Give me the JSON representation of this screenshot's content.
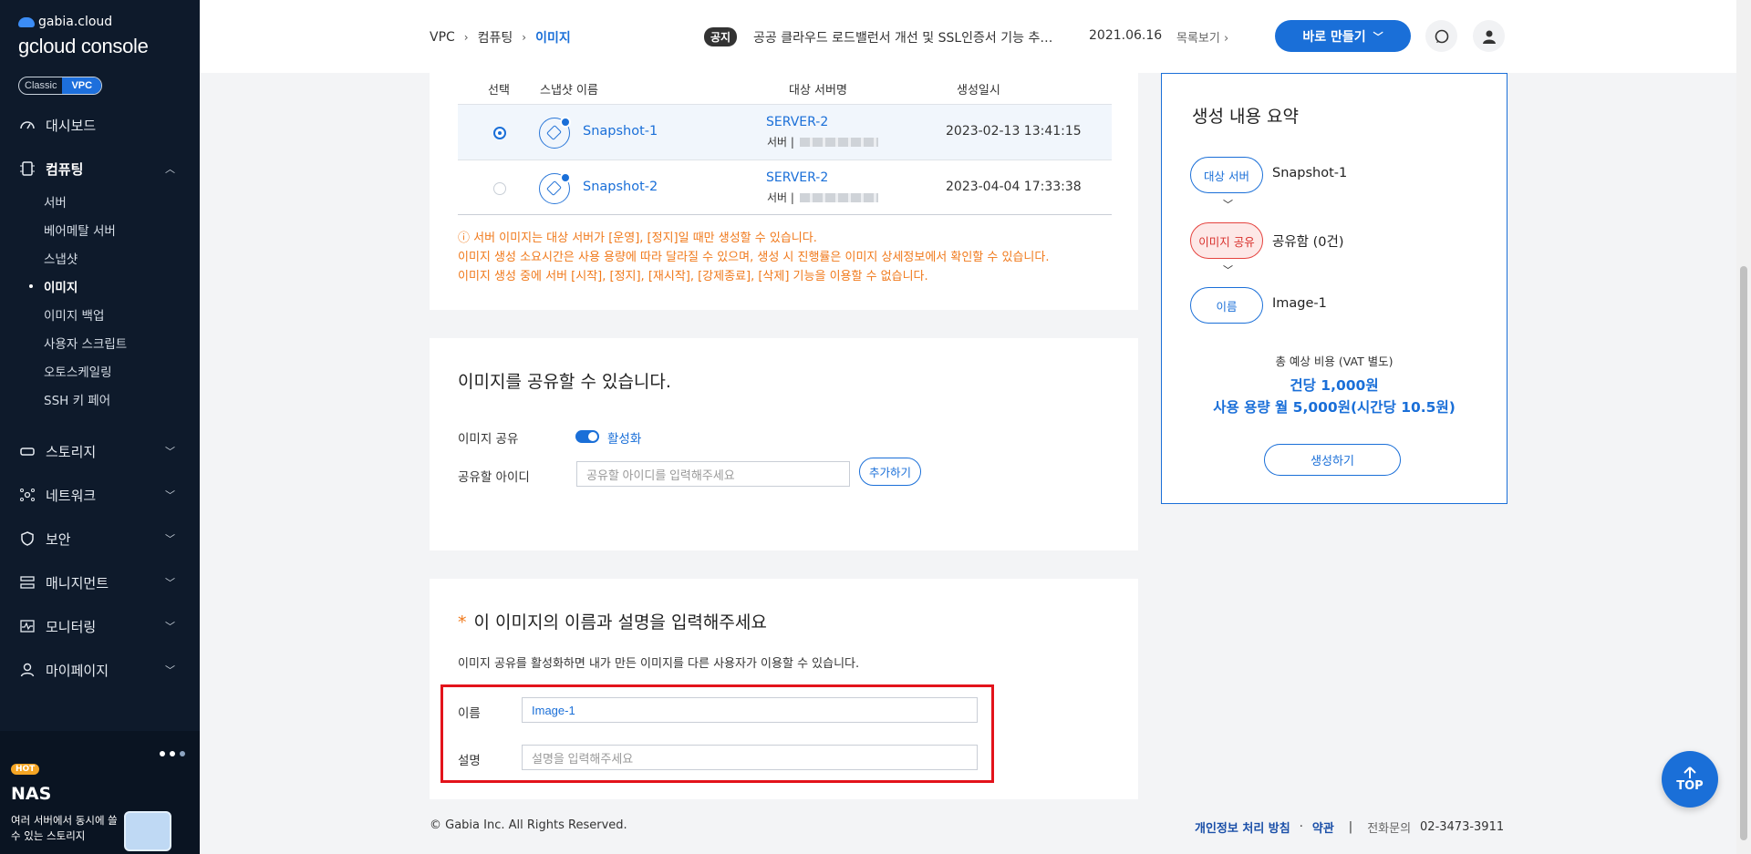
{
  "sidebar": {
    "brand_top": "gabia.cloud",
    "brand_main": "gcloud console",
    "mode_classic": "Classic",
    "mode_vpc": "VPC",
    "nav": [
      {
        "label": "대시보드"
      },
      {
        "label": "컴퓨팅"
      },
      {
        "label": "스토리지"
      },
      {
        "label": "네트워크"
      },
      {
        "label": "보안"
      },
      {
        "label": "매니지먼트"
      },
      {
        "label": "모니터링"
      },
      {
        "label": "마이페이지"
      }
    ],
    "sub": [
      {
        "label": "서버"
      },
      {
        "label": "베어메탈 서버"
      },
      {
        "label": "스냅샷"
      },
      {
        "label": "이미지"
      },
      {
        "label": "이미지 백업"
      },
      {
        "label": "사용자 스크립트"
      },
      {
        "label": "오토스케일링"
      },
      {
        "label": "SSH 키 페어"
      }
    ],
    "promo": {
      "badge": "HOT",
      "title": "NAS",
      "desc": "여러 서버에서 동시에 쓸 수 있는 스토리지"
    }
  },
  "header": {
    "breadcrumb": [
      "VPC",
      "컴퓨팅",
      "이미지"
    ],
    "notice_badge": "공지",
    "notice_text": "공공 클라우드 로드밸런서 개선 및 SSL인증서 기능 추…",
    "notice_date": "2021.06.16",
    "notice_more": "목록보기",
    "make_button": "바로 만들기"
  },
  "snapshot_table": {
    "headers": [
      "선택",
      "스냅샷 이름",
      "대상 서버명",
      "생성일시"
    ],
    "rows": [
      {
        "name": "Snapshot-1",
        "server": "SERVER-2",
        "server_sub": "서버 |",
        "created": "2023-02-13 13:41:15",
        "selected": true
      },
      {
        "name": "Snapshot-2",
        "server": "SERVER-2",
        "server_sub": "서버 |",
        "created": "2023-04-04 17:33:38",
        "selected": false
      }
    ],
    "warnings": [
      "ⓘ 서버 이미지는 대상 서버가 [운영], [정지]일 때만 생성할 수 있습니다.",
      "이미지 생성 소요시간은 사용 용량에 따라 달라질 수 있으며, 생성 시 진행률은 이미지 상세정보에서 확인할 수 있습니다.",
      "이미지 생성 중에 서버 [시작], [정지], [재시작], [강제종료], [삭제] 기능을 이용할 수 없습니다."
    ]
  },
  "share": {
    "title": "이미지를 공유할 수 있습니다.",
    "share_label": "이미지 공유",
    "toggle_label": "활성화",
    "toggle_on": true,
    "id_label": "공유할 아이디",
    "id_placeholder": "공유할 아이디를 입력해주세요",
    "add_button": "추가하기"
  },
  "name_section": {
    "asterisk": "*",
    "title": "이 이미지의 이름과 설명을 입력해주세요",
    "desc": "이미지 공유를 활성화하면 내가 만든 이미지를 다른 사용자가 이용할 수 있습니다.",
    "name_label": "이름",
    "name_value": "Image-1",
    "desc_label": "설명",
    "desc_placeholder": "설명을 입력해주세요"
  },
  "summary": {
    "title": "생성 내용 요약",
    "items": [
      {
        "tag": "대상 서버",
        "value": "Snapshot-1"
      },
      {
        "tag": "이미지 공유",
        "value": "공유함 (0건)"
      },
      {
        "tag": "이름",
        "value": "Image-1"
      }
    ],
    "cost_label": "총 예상 비용 (VAT 별도)",
    "cost_line1": "건당 1,000원",
    "cost_line2": "사용 용량 월 5,000원(시간당 10.5원)",
    "create_button": "생성하기"
  },
  "footer": {
    "copyright": "© Gabia Inc. All Rights Reserved.",
    "privacy": "개인정보 처리 방침",
    "dot": "·",
    "terms": "약관",
    "bar": "|",
    "phone_label": "전화문의",
    "phone": "02-3473-3911"
  },
  "top_button": "TOP",
  "colors": {
    "accent": "#1a6fd8",
    "sidebar_bg": "#0e1a2b",
    "warning": "#f0791b",
    "highlight": "#e3131b"
  }
}
